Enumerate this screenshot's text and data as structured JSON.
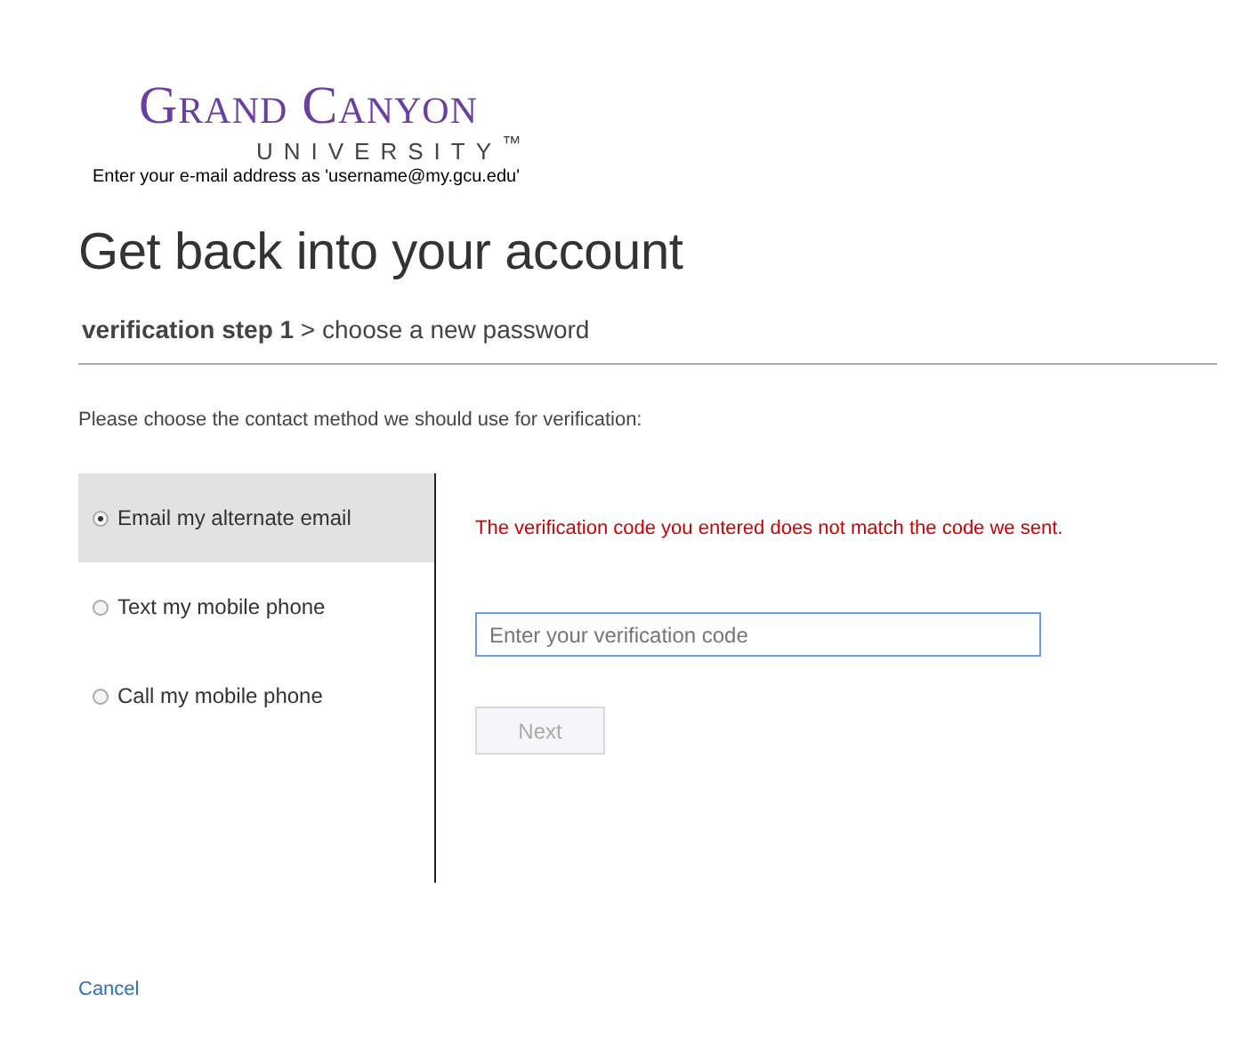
{
  "logo": {
    "name": "Grand Canyon",
    "sub": "UNIVERSITY$^{™}$"
  },
  "hint": "Enter your e-mail address as 'username@my.gcu.edu'",
  "title": "Get back into your account",
  "breadcrumb": "**verification step 1** > choose a new password",
  "instructions": "Please choose the contact method we should use for verification:",
  "methods": [
    {
      "label": "Email my alternate email",
      "selected": true
    },
    {
      "label": "Text my mobile phone",
      "selected": false
    },
    {
      "label": "Call my mobile phone",
      "selected": false
    }
  ],
  "error": "The verification code you entered does not match the code we sent.",
  "code_field": {
    "placeholder": "Enter your verification code",
    "focused": true
  },
  "next_button": {
    "label": "Next",
    "disabled": true
  },
  "cancel_link": "Cancel"
}
